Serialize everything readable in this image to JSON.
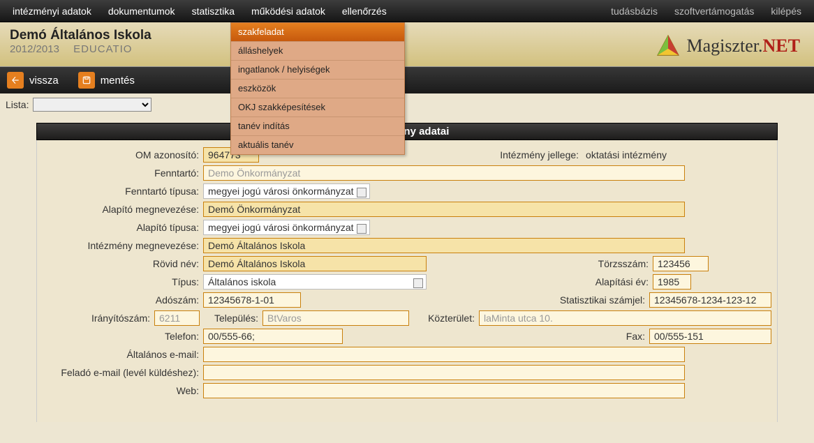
{
  "menubar": {
    "left": [
      "intézményi adatok",
      "dokumentumok",
      "statisztika",
      "működési adatok",
      "ellenőrzés"
    ],
    "right": [
      "tudásbázis",
      "szoftvertámogatás",
      "kilépés"
    ]
  },
  "submenu": [
    "szakfeladat",
    "álláshelyek",
    "ingatlanok / helyiségek",
    "eszközök",
    "OKJ szakképesítések",
    "tanév indítás",
    "aktuális tanév"
  ],
  "title": {
    "school": "Demó Általános Iskola",
    "year": "2012/2013",
    "edu": "EDUCATIO",
    "brand_left": "Magiszter.",
    "brand_right": "NET"
  },
  "actionbar": {
    "back": "vissza",
    "save": "mentés"
  },
  "lista_label": "Lista:",
  "panel_header": "Intézmény adatai",
  "labels": {
    "om": "OM azonosító:",
    "jelleg_label": "Intézmény jellege:",
    "jelleg_value": "oktatási intézmény",
    "fenntarto": "Fenntartó:",
    "fenntarto_tip": "Fenntartó típusa:",
    "alapito_meg": "Alapító megnevezése:",
    "alapito_tip": "Alapító típusa:",
    "intezmeny_meg": "Intézmény megnevezése:",
    "rovid": "Rövid név:",
    "torzsszam": "Törzsszám:",
    "tipus": "Típus:",
    "alapitasi": "Alapítási év:",
    "adoszam": "Adószám:",
    "stat": "Statisztikai számjel:",
    "irsz": "Irányítószám:",
    "telepules": "Település:",
    "kozterulet": "Közterület:",
    "telefon": "Telefon:",
    "fax": "Fax:",
    "alt_email": "Általános e-mail:",
    "felado_email": "Feladó e-mail (levél küldéshez):",
    "web": "Web:"
  },
  "values": {
    "om": "964773",
    "fenntarto": "Demo Önkormányzat",
    "fenntarto_tip": "megyei jogú városi önkormányzat",
    "alapito_meg": "Demó Önkormányzat",
    "alapito_tip": "megyei jogú városi önkormányzat",
    "intezmeny_meg": "Demó Általános Iskola",
    "rovid": "Demó Általános Iskola",
    "torzsszam": "123456",
    "tipus": "Általános iskola",
    "alapitasi": "1985",
    "adoszam": "12345678-1-01",
    "stat": "12345678-1234-123-12",
    "irsz": "6211",
    "telepules": "BtVaros",
    "kozterulet": "laMinta utca 10.",
    "telefon": "00/555-66;",
    "fax": "00/555-151",
    "alt_email": "",
    "felado_email": "",
    "web": ""
  }
}
